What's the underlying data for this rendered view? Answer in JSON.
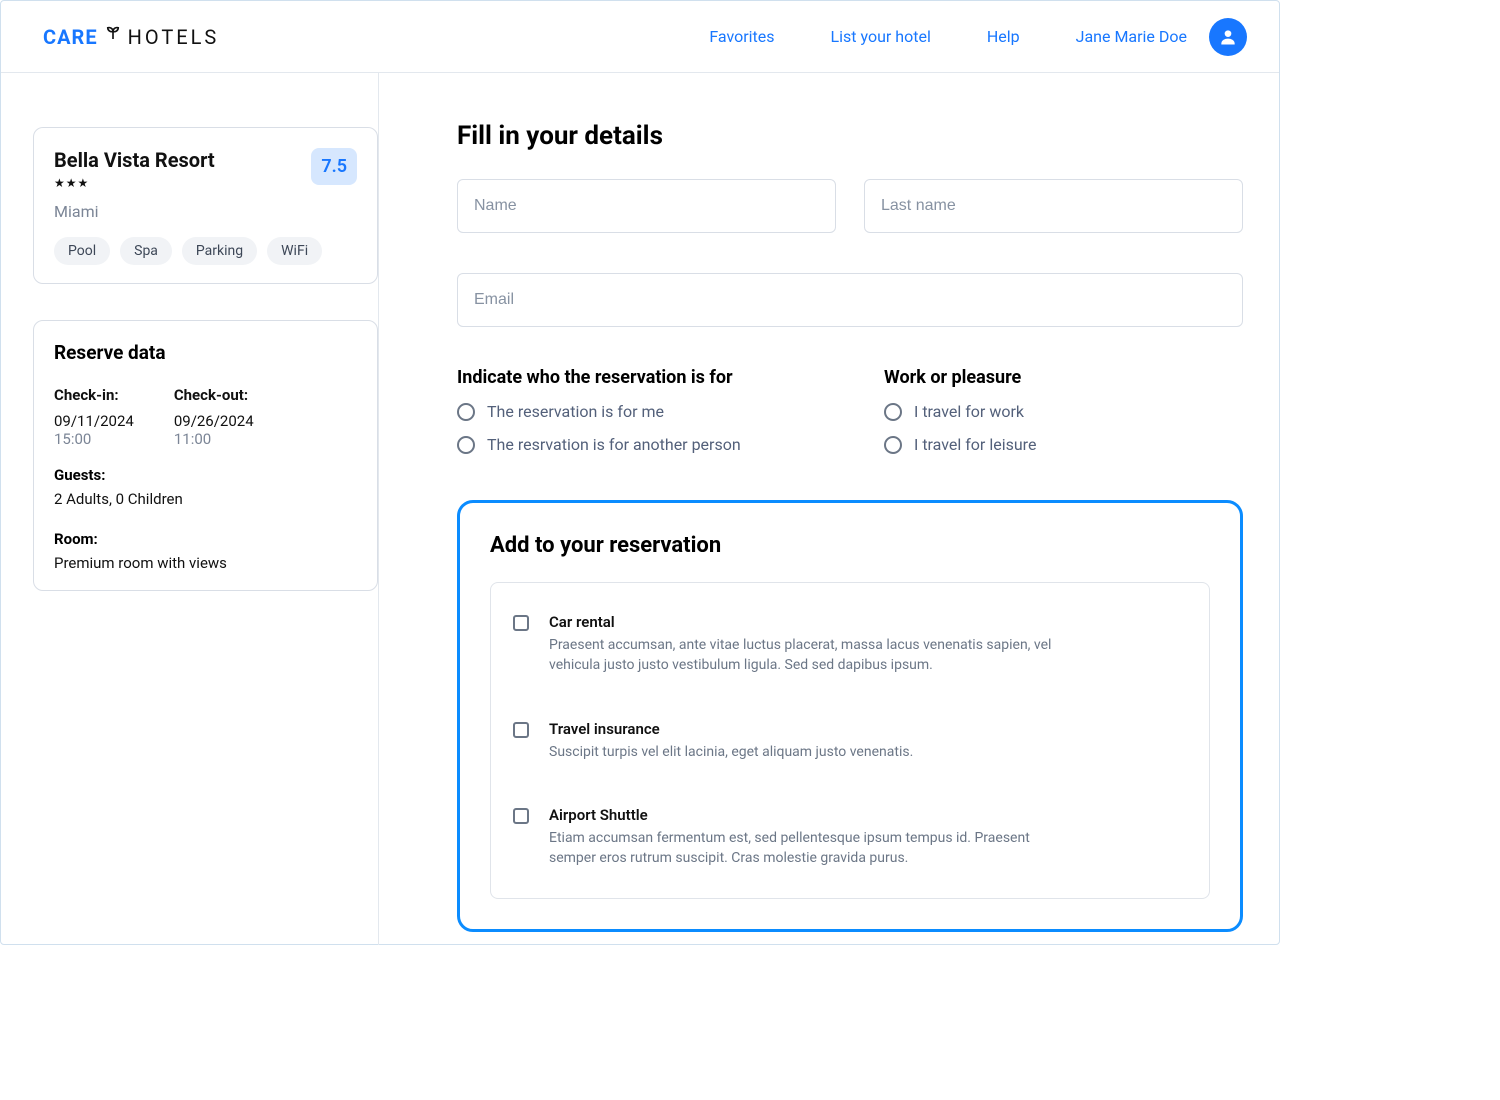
{
  "header": {
    "logo_care": "CARE",
    "logo_hotels": "HOTELS",
    "nav": {
      "favorites": "Favorites",
      "list": "List your hotel",
      "help": "Help"
    },
    "user_name": "Jane Marie Doe"
  },
  "hotel": {
    "name": "Bella Vista Resort",
    "rating": "7.5",
    "city": "Miami",
    "stars": 3,
    "amenities": [
      "Pool",
      "Spa",
      "Parking",
      "WiFi"
    ]
  },
  "reserve": {
    "title": "Reserve data",
    "checkin_label": "Check-in:",
    "checkout_label": "Check-out:",
    "checkin_date": "09/11/2024",
    "checkin_time": "15:00",
    "checkout_date": "09/26/2024",
    "checkout_time": "11:00",
    "guests_label": "Guests:",
    "guests_value": "2 Adults,   0 Children",
    "room_label": "Room:",
    "room_value": "Premium room with views"
  },
  "form": {
    "title": "Fill in your details",
    "name_ph": "Name",
    "lastname_ph": "Last name",
    "email_ph": "Email",
    "q1_title": "Indicate who the reservation is for",
    "q1_opt1": "The reservation is for me",
    "q1_opt2": "The resrvation is for another person",
    "q2_title": "Work or pleasure",
    "q2_opt1": "I travel for work",
    "q2_opt2": "I travel for leisure"
  },
  "addons": {
    "title": "Add to your reservation",
    "items": [
      {
        "title": "Car rental",
        "desc": "Praesent accumsan, ante vitae luctus placerat, massa lacus venenatis sapien, vel vehicula justo justo vestibulum ligula. Sed sed dapibus ipsum."
      },
      {
        "title": "Travel insurance",
        "desc": "Suscipit turpis vel elit lacinia, eget aliquam justo venenatis."
      },
      {
        "title": "Airport Shuttle",
        "desc": "Etiam accumsan fermentum est, sed pellentesque ipsum tempus id. Praesent semper eros rutrum suscipit. Cras molestie gravida purus."
      }
    ]
  }
}
